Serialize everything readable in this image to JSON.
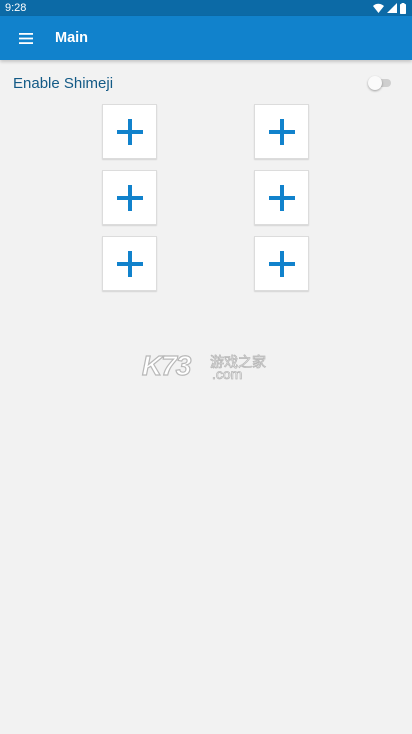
{
  "status_bar": {
    "time": "9:28",
    "icons": [
      "wifi-icon",
      "signal-icon",
      "battery-icon"
    ]
  },
  "app_bar": {
    "title": "Main",
    "menu_icon": "hamburger-menu-icon"
  },
  "settings": {
    "enable_label": "Enable Shimeji",
    "enabled": false
  },
  "shimeji_slots": [
    {
      "icon": "plus-icon"
    },
    {
      "icon": "plus-icon"
    },
    {
      "icon": "plus-icon"
    },
    {
      "icon": "plus-icon"
    },
    {
      "icon": "plus-icon"
    },
    {
      "icon": "plus-icon"
    }
  ],
  "watermark": {
    "main": "K73",
    "sub": "游戏之家",
    "domain": ".com"
  },
  "colors": {
    "status_bar": "#0c6aa6",
    "app_bar": "#1182cc",
    "accent": "#1182cc",
    "background": "#f2f2f2",
    "label_text": "#135a86"
  }
}
